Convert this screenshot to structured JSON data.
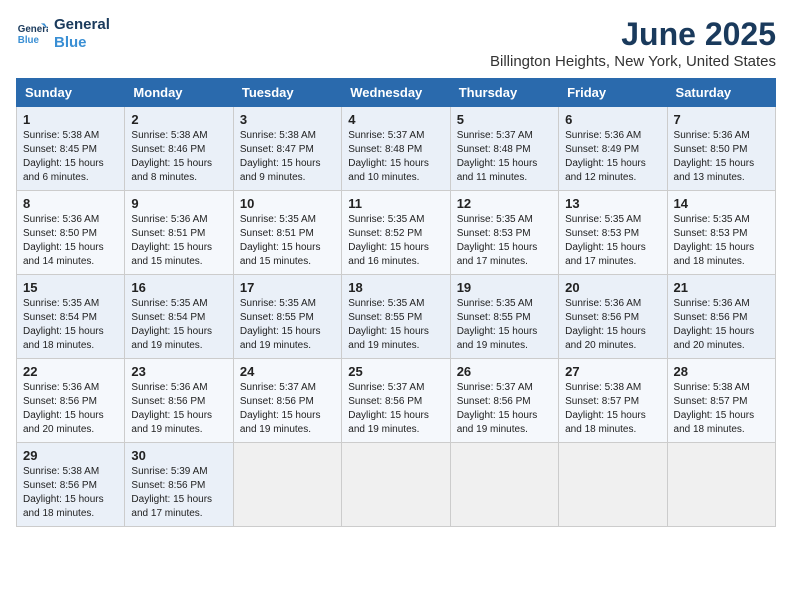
{
  "header": {
    "logo_line1": "General",
    "logo_line2": "Blue",
    "title": "June 2025",
    "subtitle": "Billington Heights, New York, United States"
  },
  "days_of_week": [
    "Sunday",
    "Monday",
    "Tuesday",
    "Wednesday",
    "Thursday",
    "Friday",
    "Saturday"
  ],
  "weeks": [
    [
      {
        "day": "1",
        "sunrise": "Sunrise: 5:38 AM",
        "sunset": "Sunset: 8:45 PM",
        "daylight": "Daylight: 15 hours and 6 minutes."
      },
      {
        "day": "2",
        "sunrise": "Sunrise: 5:38 AM",
        "sunset": "Sunset: 8:46 PM",
        "daylight": "Daylight: 15 hours and 8 minutes."
      },
      {
        "day": "3",
        "sunrise": "Sunrise: 5:38 AM",
        "sunset": "Sunset: 8:47 PM",
        "daylight": "Daylight: 15 hours and 9 minutes."
      },
      {
        "day": "4",
        "sunrise": "Sunrise: 5:37 AM",
        "sunset": "Sunset: 8:48 PM",
        "daylight": "Daylight: 15 hours and 10 minutes."
      },
      {
        "day": "5",
        "sunrise": "Sunrise: 5:37 AM",
        "sunset": "Sunset: 8:48 PM",
        "daylight": "Daylight: 15 hours and 11 minutes."
      },
      {
        "day": "6",
        "sunrise": "Sunrise: 5:36 AM",
        "sunset": "Sunset: 8:49 PM",
        "daylight": "Daylight: 15 hours and 12 minutes."
      },
      {
        "day": "7",
        "sunrise": "Sunrise: 5:36 AM",
        "sunset": "Sunset: 8:50 PM",
        "daylight": "Daylight: 15 hours and 13 minutes."
      }
    ],
    [
      {
        "day": "8",
        "sunrise": "Sunrise: 5:36 AM",
        "sunset": "Sunset: 8:50 PM",
        "daylight": "Daylight: 15 hours and 14 minutes."
      },
      {
        "day": "9",
        "sunrise": "Sunrise: 5:36 AM",
        "sunset": "Sunset: 8:51 PM",
        "daylight": "Daylight: 15 hours and 15 minutes."
      },
      {
        "day": "10",
        "sunrise": "Sunrise: 5:35 AM",
        "sunset": "Sunset: 8:51 PM",
        "daylight": "Daylight: 15 hours and 15 minutes."
      },
      {
        "day": "11",
        "sunrise": "Sunrise: 5:35 AM",
        "sunset": "Sunset: 8:52 PM",
        "daylight": "Daylight: 15 hours and 16 minutes."
      },
      {
        "day": "12",
        "sunrise": "Sunrise: 5:35 AM",
        "sunset": "Sunset: 8:53 PM",
        "daylight": "Daylight: 15 hours and 17 minutes."
      },
      {
        "day": "13",
        "sunrise": "Sunrise: 5:35 AM",
        "sunset": "Sunset: 8:53 PM",
        "daylight": "Daylight: 15 hours and 17 minutes."
      },
      {
        "day": "14",
        "sunrise": "Sunrise: 5:35 AM",
        "sunset": "Sunset: 8:53 PM",
        "daylight": "Daylight: 15 hours and 18 minutes."
      }
    ],
    [
      {
        "day": "15",
        "sunrise": "Sunrise: 5:35 AM",
        "sunset": "Sunset: 8:54 PM",
        "daylight": "Daylight: 15 hours and 18 minutes."
      },
      {
        "day": "16",
        "sunrise": "Sunrise: 5:35 AM",
        "sunset": "Sunset: 8:54 PM",
        "daylight": "Daylight: 15 hours and 19 minutes."
      },
      {
        "day": "17",
        "sunrise": "Sunrise: 5:35 AM",
        "sunset": "Sunset: 8:55 PM",
        "daylight": "Daylight: 15 hours and 19 minutes."
      },
      {
        "day": "18",
        "sunrise": "Sunrise: 5:35 AM",
        "sunset": "Sunset: 8:55 PM",
        "daylight": "Daylight: 15 hours and 19 minutes."
      },
      {
        "day": "19",
        "sunrise": "Sunrise: 5:35 AM",
        "sunset": "Sunset: 8:55 PM",
        "daylight": "Daylight: 15 hours and 19 minutes."
      },
      {
        "day": "20",
        "sunrise": "Sunrise: 5:36 AM",
        "sunset": "Sunset: 8:56 PM",
        "daylight": "Daylight: 15 hours and 20 minutes."
      },
      {
        "day": "21",
        "sunrise": "Sunrise: 5:36 AM",
        "sunset": "Sunset: 8:56 PM",
        "daylight": "Daylight: 15 hours and 20 minutes."
      }
    ],
    [
      {
        "day": "22",
        "sunrise": "Sunrise: 5:36 AM",
        "sunset": "Sunset: 8:56 PM",
        "daylight": "Daylight: 15 hours and 20 minutes."
      },
      {
        "day": "23",
        "sunrise": "Sunrise: 5:36 AM",
        "sunset": "Sunset: 8:56 PM",
        "daylight": "Daylight: 15 hours and 19 minutes."
      },
      {
        "day": "24",
        "sunrise": "Sunrise: 5:37 AM",
        "sunset": "Sunset: 8:56 PM",
        "daylight": "Daylight: 15 hours and 19 minutes."
      },
      {
        "day": "25",
        "sunrise": "Sunrise: 5:37 AM",
        "sunset": "Sunset: 8:56 PM",
        "daylight": "Daylight: 15 hours and 19 minutes."
      },
      {
        "day": "26",
        "sunrise": "Sunrise: 5:37 AM",
        "sunset": "Sunset: 8:56 PM",
        "daylight": "Daylight: 15 hours and 19 minutes."
      },
      {
        "day": "27",
        "sunrise": "Sunrise: 5:38 AM",
        "sunset": "Sunset: 8:57 PM",
        "daylight": "Daylight: 15 hours and 18 minutes."
      },
      {
        "day": "28",
        "sunrise": "Sunrise: 5:38 AM",
        "sunset": "Sunset: 8:57 PM",
        "daylight": "Daylight: 15 hours and 18 minutes."
      }
    ],
    [
      {
        "day": "29",
        "sunrise": "Sunrise: 5:38 AM",
        "sunset": "Sunset: 8:56 PM",
        "daylight": "Daylight: 15 hours and 18 minutes."
      },
      {
        "day": "30",
        "sunrise": "Sunrise: 5:39 AM",
        "sunset": "Sunset: 8:56 PM",
        "daylight": "Daylight: 15 hours and 17 minutes."
      },
      {
        "day": "",
        "sunrise": "",
        "sunset": "",
        "daylight": ""
      },
      {
        "day": "",
        "sunrise": "",
        "sunset": "",
        "daylight": ""
      },
      {
        "day": "",
        "sunrise": "",
        "sunset": "",
        "daylight": ""
      },
      {
        "day": "",
        "sunrise": "",
        "sunset": "",
        "daylight": ""
      },
      {
        "day": "",
        "sunrise": "",
        "sunset": "",
        "daylight": ""
      }
    ]
  ]
}
